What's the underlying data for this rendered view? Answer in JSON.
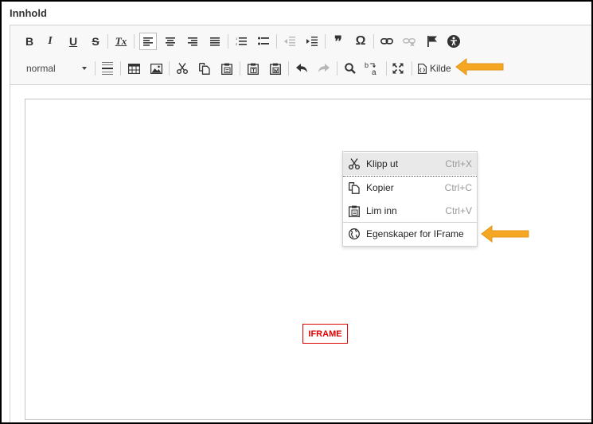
{
  "section": {
    "title": "Innhold"
  },
  "toolbar": {
    "format_value": "normal",
    "kilde_label": "Kilde",
    "quote_glyph": "❞",
    "omega_glyph": "Ω"
  },
  "icons": {
    "bold": "B",
    "italic": "I",
    "underline": "U",
    "strike": "S",
    "clear_format": "Tx"
  },
  "content": {
    "iframe_placeholder": "IFRAME"
  },
  "context_menu": {
    "items": [
      {
        "label": "Klipp ut",
        "shortcut": "Ctrl+X",
        "icon": "scissors-icon"
      },
      {
        "label": "Kopier",
        "shortcut": "Ctrl+C",
        "icon": "copy-icon"
      },
      {
        "label": "Lim inn",
        "shortcut": "Ctrl+V",
        "icon": "paste-icon"
      },
      {
        "label": "Egenskaper for IFrame",
        "shortcut": "",
        "icon": "globe-icon"
      }
    ]
  },
  "colors": {
    "annotation_arrow": "#f5a623",
    "placeholder_red": "#e00000"
  }
}
